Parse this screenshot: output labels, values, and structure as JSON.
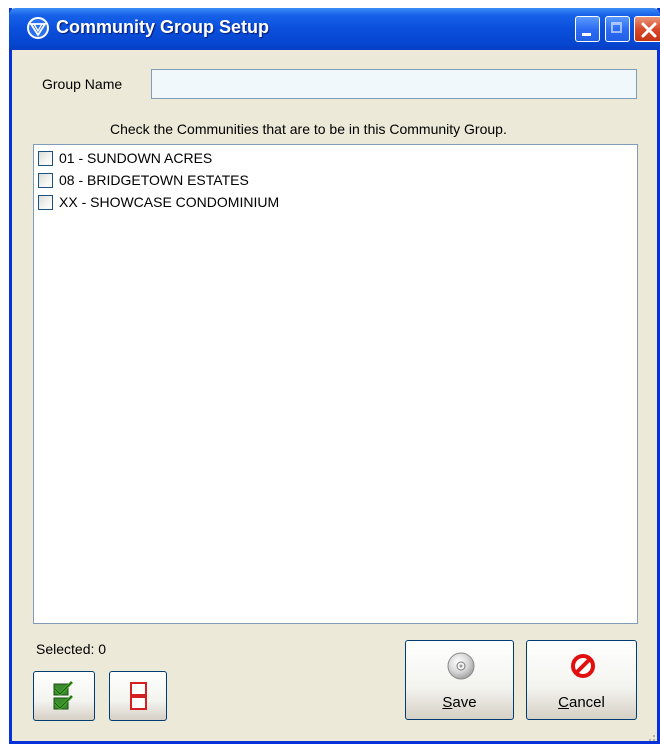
{
  "window": {
    "title": "Community Group Setup",
    "icon": "app-logo-icon"
  },
  "form": {
    "group_name_label": "Group Name",
    "group_name_value": "",
    "instruction": "Check the Communities that are to be in this Community Group."
  },
  "communities": [
    {
      "label": "01 - SUNDOWN ACRES",
      "checked": false
    },
    {
      "label": "08 - BRIDGETOWN ESTATES",
      "checked": false
    },
    {
      "label": "XX - SHOWCASE CONDOMINIUM",
      "checked": false
    }
  ],
  "status": {
    "selected_text": "Selected: 0"
  },
  "buttons": {
    "check_all_icon": "check-all-icon",
    "uncheck_all_icon": "uncheck-all-icon",
    "save_mnemonic": "S",
    "save_rest": "ave",
    "cancel_mnemonic": "C",
    "cancel_rest": "ancel"
  },
  "colors": {
    "titlebar": "#0a4fdc",
    "window_bg": "#ece9d8",
    "input_bg": "#f0f8fb",
    "close_button": "#d84a2b"
  }
}
